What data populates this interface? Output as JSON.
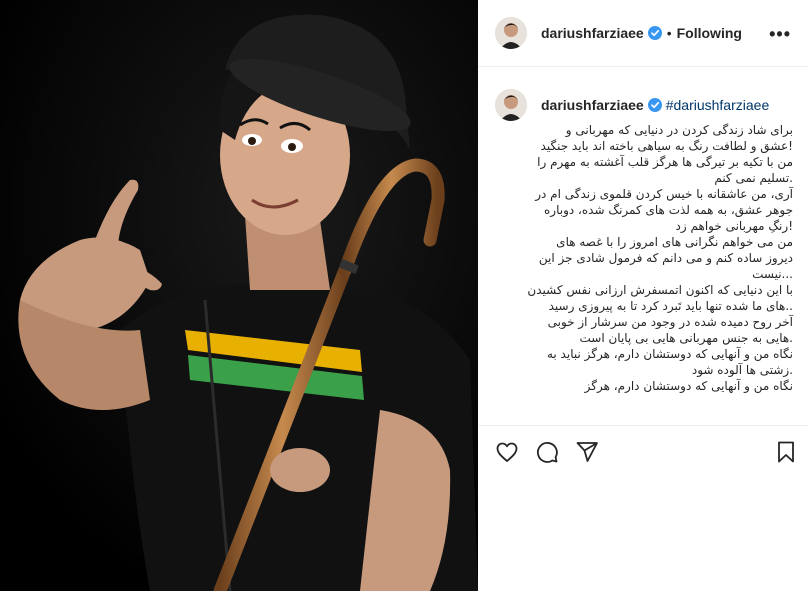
{
  "post": {
    "username": "dariushfarziaee",
    "following_label": "Following",
    "separator": "•",
    "more": "•••",
    "caption_username": "dariushfarziaee",
    "hashtag": "#dariushfarziaee",
    "caption_lines": [
      "برای شاد زندگی کردن در دنیایی که مهربانی و",
      "!عشق و لطافت رنگ به سیاهی باخته اند باید جنگید",
      "من با تکیه بر تیرگی ها هرگز قلب آغشته به مهرم را",
      ".تسلیم نمی کنم",
      "آری، من عاشقانه با خیس کردن قلموی زندگی ام در",
      "جوهر عشق، به همه لذت های کمرنگ شده، دوباره",
      "!رنگِ مهربانی خواهم زد",
      "من می خواهم نگرانی های امروز را با غصه های",
      "دیروز ساده کنم و می دانم که فرمول شادی جز این",
      "...نیست",
      "با این دنیایی که اکنون اتمسفرش ارزانی نفس کشیدن",
      "..های ما شده تنها باید تَبرد کرد تا به پیروزی رسید",
      "آخر روح دمیده شده در وجود من سرشار از خوبی",
      ".هایی به جنس مهربانی هایی بی پایان است",
      "نگاه من و آنهایی که دوستشان دارم، هرگز نباید به",
      ".زشتی ها آلوده شود",
      "نگاه من و آنهایی که دوستشان دارم، هرگز"
    ]
  },
  "icons": {
    "verified": "verified-badge-icon",
    "like": "heart-icon",
    "comment": "comment-icon",
    "share": "share-icon",
    "save": "bookmark-icon"
  },
  "colors": {
    "verified_blue": "#3897f0",
    "hashtag_blue": "#00376b",
    "text": "#262626",
    "divider": "#efefef"
  }
}
